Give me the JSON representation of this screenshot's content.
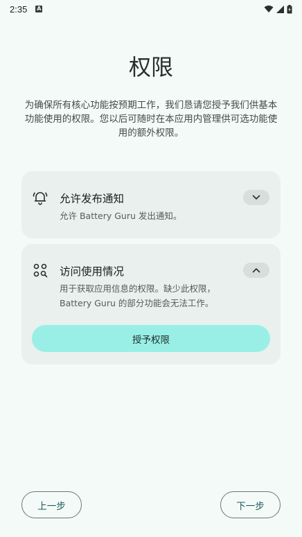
{
  "status_bar": {
    "time": "2:35",
    "notification_icon": "A"
  },
  "page": {
    "title": "权限",
    "description": "为确保所有核心功能按预期工作，我们恳请您授予我们供基本功能使用的权限。您以后可随时在本应用内管理供可选功能使用的额外权限。"
  },
  "permissions": [
    {
      "icon": "bell-icon",
      "title": "允许发布通知",
      "description": "允许 Battery Guru 发出通知。",
      "expanded": false
    },
    {
      "icon": "usage-stats-icon",
      "title": "访问使用情况",
      "description_line1": "用于获取应用信息的权限。缺少此权限，",
      "description_line2": "Battery Guru 的部分功能会无法工作。",
      "expanded": true,
      "grant_label": "授予权限"
    }
  ],
  "navigation": {
    "prev_label": "上一步",
    "next_label": "下一步"
  },
  "colors": {
    "background": "#f4faf8",
    "card": "#e9f0ee",
    "accent": "#99efe6",
    "nav_text": "#1f5a5a"
  }
}
